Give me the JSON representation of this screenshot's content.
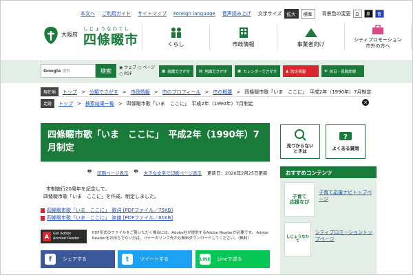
{
  "util": {
    "links": [
      "本文へ",
      "ご利用ガイド",
      "サイトマップ",
      "Foreign language",
      "音声読み上げ"
    ],
    "textsize_label": "文字サイズ",
    "size_big": "拡大",
    "size_std": "標準",
    "bgcolor_label": "背景色の変更",
    "bg_white": "白",
    "bg_black": "黒",
    "bg_blue": "青"
  },
  "header": {
    "pref": "大阪府",
    "ruby": "しじょうなわてし",
    "city": "四條畷市",
    "nav": [
      {
        "label": "くらし",
        "icon": "people-icon"
      },
      {
        "label": "市政情報",
        "icon": "building-icon"
      },
      {
        "label": "事業者向け",
        "icon": "mountain-icon"
      },
      {
        "label": "シティプロモーション\n市外の方へ",
        "icon": "bag-icon"
      }
    ]
  },
  "search": {
    "google": "Google",
    "placeholder": "提供",
    "button": "検索",
    "radio_web": "ウェブ",
    "radio_page": "ページ",
    "radio_pdf": "PDF"
  },
  "tools": [
    {
      "label": "組織でさがす",
      "color": "#1a7a3a"
    },
    {
      "label": "地図でさがす",
      "color": "#1a7a3a"
    },
    {
      "label": "カレンダーでさがす",
      "color": "#1a7a3a"
    },
    {
      "label": "防災情報",
      "color": "#d8272e"
    },
    {
      "label": "休日・夜間診療",
      "color": "#1a7a3a"
    }
  ],
  "breadcrumb1": {
    "tag": "現在地",
    "items": [
      "トップ",
      "分類でさがす",
      "市政情報",
      "市のプロフィール",
      "市の概要"
    ],
    "current": "四條畷市歌「いま　ここに」　平成2年（1990年）7月制定"
  },
  "breadcrumb2": {
    "tag": "足跡",
    "items": [
      "トップ",
      "検索結果一覧"
    ],
    "current": "四條畷市歌「いま　ここに」　平成2年（1990年）7月制定"
  },
  "page": {
    "title": "四條畷市歌「いま　ここに」　平成2年（1990年）7月制定",
    "print": "印刷ページ表示",
    "bigprint": "大きな文字で印刷ページ表示",
    "updated": "更新日：2020年2月25日更新",
    "body1": "市制施行20周年を記念して、",
    "body2": "四條畷市歌「いま　ここに」を作成、制定しました。",
    "link1": "四條畷市歌「いま　ここに」　歌詞 [PDFファイル／75KB]",
    "link2": "四條畷市歌「いま　ここに」　楽譜 [PDFファイル／81KB]",
    "adobe_badge1": "Get Adobe",
    "adobe_badge2": "Acrobat Reader",
    "adobe_note": "PDF形式のファイルをご覧いただく場合には、Adobe社が提供するAdobe Readerが必要です。 Adobe Readerをお持ちでない方は、バナーのリンク先から無料ダウンロードしてください。（無料）"
  },
  "share": {
    "facebook": "シェアする",
    "twitter": "ツイートする",
    "line": "Lineで送る"
  },
  "side": {
    "faq_missing": "見つからない\nときは",
    "faq": "よくある質問",
    "rec_title": "おすすめコンテンツ",
    "rec1_img": "子育て\n応援なび",
    "rec1_link": "子育て応援ナビトップページ",
    "rec2_img": "しじょうなわて",
    "rec2_link": "シティプロモーショントップページ"
  }
}
